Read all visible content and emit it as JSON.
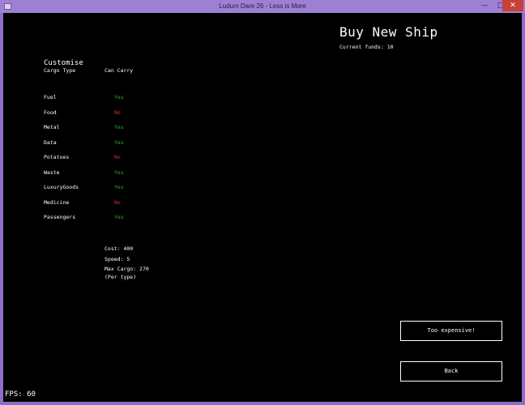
{
  "window": {
    "title": "Ludum Dare 26 - Less is More",
    "minimize": "—",
    "maximize": "□",
    "close": "✕"
  },
  "header": {
    "title": "Buy New Ship",
    "funds_label": "Current funds:",
    "funds_value": "10"
  },
  "customise": {
    "title": "Customise",
    "col_cargo": "Cargo Type",
    "col_carry": "Can Carry",
    "rows": [
      {
        "type": "Fuel",
        "carry": "Yes"
      },
      {
        "type": "Food",
        "carry": "No"
      },
      {
        "type": "Metal",
        "carry": "Yes"
      },
      {
        "type": "Data",
        "carry": "Yes"
      },
      {
        "type": "Potatoes",
        "carry": "No"
      },
      {
        "type": "Waste",
        "carry": "Yes"
      },
      {
        "type": "LuxuryGoods",
        "carry": "Yes"
      },
      {
        "type": "Medicine",
        "carry": "No"
      },
      {
        "type": "Passengers",
        "carry": "Yes"
      }
    ]
  },
  "stats": {
    "cost": "Cost: 400",
    "speed": "Speed: 5",
    "max_cargo": "Max Cargo: 270",
    "per_type": "(Per type)"
  },
  "buttons": {
    "buy": "Too expensive!",
    "back": "Back"
  },
  "fps": "FPS: 60",
  "colors": {
    "yes": "#2fa82f",
    "no": "#d63030",
    "background": "#000000",
    "frame": "#9d7fd4"
  }
}
